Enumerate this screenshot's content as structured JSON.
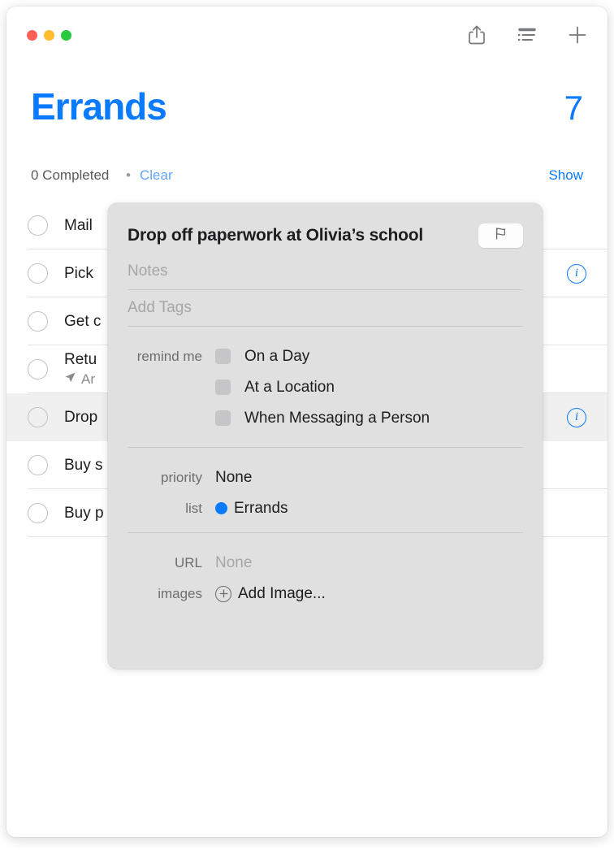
{
  "window": {
    "traffic_lights": [
      {
        "name": "close",
        "color": "#FF5F57"
      },
      {
        "name": "minimize",
        "color": "#FEBC2E"
      },
      {
        "name": "maximize",
        "color": "#28C840"
      }
    ]
  },
  "toolbar": {
    "share_icon": "share-icon",
    "view_options_icon": "list-view-icon",
    "add_icon": "plus-icon"
  },
  "header": {
    "list_title": "Errands",
    "count": "7",
    "completed_text": "0 Completed",
    "separator": "•",
    "clear_label": "Clear",
    "show_label": "Show",
    "accent_color": "#0A7AFF",
    "clear_color": "#62A5FB"
  },
  "reminders": [
    {
      "title": "Mail",
      "subtitle": "",
      "selected": false,
      "info": false
    },
    {
      "title": "Pick",
      "subtitle": "",
      "selected": false,
      "info": true
    },
    {
      "title": "Get c",
      "subtitle": "",
      "selected": false,
      "info": false
    },
    {
      "title": "Retu",
      "subtitle": "Ar",
      "subtitle_icon": "location-arrow-icon",
      "selected": false,
      "info": false
    },
    {
      "title": "Drop",
      "subtitle": "",
      "selected": true,
      "info": true
    },
    {
      "title": "Buy s",
      "subtitle": "",
      "selected": false,
      "info": false
    },
    {
      "title": "Buy p",
      "subtitle": "",
      "selected": false,
      "info": false
    }
  ],
  "popover": {
    "title": "Drop off paperwork at Olivia’s school",
    "flag_icon": "flag-icon",
    "notes_placeholder": "Notes",
    "tags_placeholder": "Add Tags",
    "remind_me": {
      "label": "remind me",
      "options": [
        {
          "label": "On a Day",
          "checked": false
        },
        {
          "label": "At a Location",
          "checked": false
        },
        {
          "label": "When Messaging a Person",
          "checked": false
        }
      ]
    },
    "priority": {
      "label": "priority",
      "value": "None"
    },
    "list": {
      "label": "list",
      "value": "Errands",
      "dot_color": "#0A7AFF"
    },
    "url": {
      "label": "URL",
      "value": "None"
    },
    "images": {
      "label": "images",
      "value": "Add Image...",
      "add_icon": "plus-circle-icon"
    }
  }
}
